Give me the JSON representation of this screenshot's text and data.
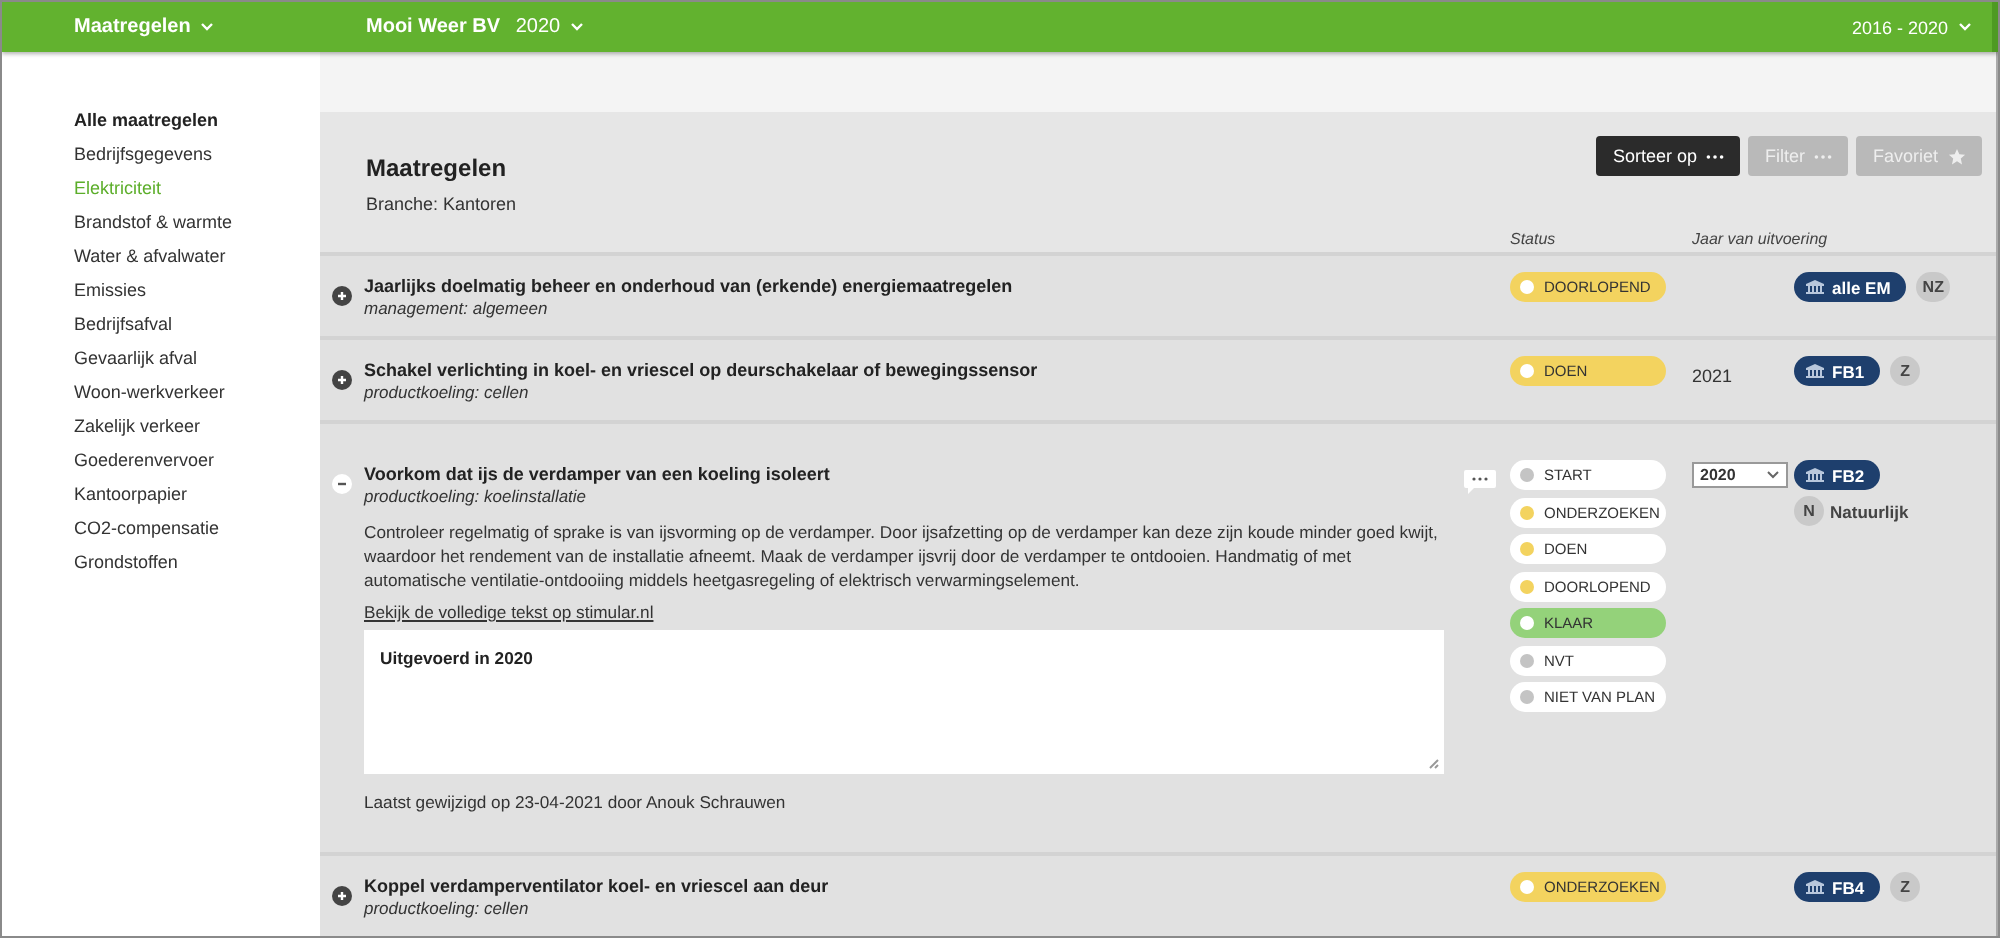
{
  "topbar": {
    "menu": "Maatregelen",
    "company": "Mooi Weer BV",
    "year": "2020",
    "period": "2016 - 2020"
  },
  "sidebar": {
    "items": [
      {
        "label": "Alle maatregelen",
        "kind": "heading",
        "selected": false
      },
      {
        "label": "Bedrijfsgegevens",
        "kind": "link",
        "selected": false
      },
      {
        "label": "Elektriciteit",
        "kind": "link",
        "selected": true
      },
      {
        "label": "Brandstof & warmte",
        "kind": "link",
        "selected": false
      },
      {
        "label": "Water & afvalwater",
        "kind": "link",
        "selected": false
      },
      {
        "label": "Emissies",
        "kind": "link",
        "selected": false
      },
      {
        "label": "Bedrijfsafval",
        "kind": "link",
        "selected": false
      },
      {
        "label": "Gevaarlijk afval",
        "kind": "link",
        "selected": false
      },
      {
        "label": "Woon-werkverkeer",
        "kind": "link",
        "selected": false
      },
      {
        "label": "Zakelijk verkeer",
        "kind": "link",
        "selected": false
      },
      {
        "label": "Goederenvervoer",
        "kind": "link",
        "selected": false
      },
      {
        "label": "Kantoorpapier",
        "kind": "link",
        "selected": false
      },
      {
        "label": "CO2-compensatie",
        "kind": "link",
        "selected": false
      },
      {
        "label": "Grondstoffen",
        "kind": "link",
        "selected": false
      }
    ]
  },
  "header": {
    "title": "Maatregelen",
    "branch": "Branche: Kantoren",
    "buttons": [
      {
        "label": "Sorteer op",
        "disabled": false
      },
      {
        "label": "Filter",
        "disabled": true
      },
      {
        "label": "Favoriet",
        "disabled": true
      }
    ],
    "columns": [
      "Status",
      "Jaar van uitvoering"
    ]
  },
  "rows": [
    {
      "expanded": false,
      "title": "Jaarlijks doelmatig beheer en onderhoud van (erkende) energiemaatregelen",
      "category": "management: algemeen",
      "status": {
        "label": "DOORLOPEND",
        "color": "#f3d35f"
      },
      "tags": [
        {
          "kind": "code",
          "label": "alle EM"
        },
        {
          "kind": "letter",
          "label": "NZ"
        }
      ]
    },
    {
      "expanded": false,
      "title": "Schakel verlichting in koel- en vriescel op deurschakelaar of bewegingssensor",
      "category": "productkoeling: cellen",
      "status": {
        "label": "DOEN",
        "color": "#f3d35f"
      },
      "year": "2021",
      "tags": [
        {
          "kind": "code",
          "label": "FB1"
        },
        {
          "kind": "letter",
          "label": "Z"
        }
      ]
    },
    {
      "expanded": true,
      "title": "Voorkom dat ijs de verdamper van een koeling isoleert",
      "category": "productkoeling: koelinstallatie",
      "description": "Controleer regelmatig of sprake is van ijsvorming op de verdamper. Door ijsafzetting op de verdamper kan deze zijn koude minder goed kwijt, waardoor het rendement van de installatie afneemt. Maak de verdamper ijsvrij door de verdamper te ontdooien. Handmatig of met automatische ventilatie-ontdooiing middels heetgasregeling of elektrisch verwarmingselement.",
      "link": "Bekijk de volledige tekst op stimular.nl",
      "note": "Uitgevoerd in 2020",
      "modified": "Laatst gewijzigd op 23-04-2021 door Anouk Schrauwen",
      "status_options": [
        {
          "label": "START",
          "color": "#c4c4c4",
          "selected": false
        },
        {
          "label": "ONDERZOEKEN",
          "color": "#f3d35f",
          "selected": false
        },
        {
          "label": "DOEN",
          "color": "#f3d35f",
          "selected": false
        },
        {
          "label": "DOORLOPEND",
          "color": "#f3d35f",
          "selected": false
        },
        {
          "label": "KLAAR",
          "color": "#ffffff",
          "selected": true
        },
        {
          "label": "NVT",
          "color": "#c4c4c4",
          "selected": false
        },
        {
          "label": "NIET VAN PLAN",
          "color": "#c4c4c4",
          "selected": false
        }
      ],
      "year_select": "2020",
      "tags": [
        {
          "kind": "code",
          "label": "FB2"
        },
        {
          "kind": "letter",
          "label": "N",
          "text": "Natuurlijk"
        }
      ]
    },
    {
      "expanded": false,
      "title": "Koppel verdamperventilator koel- en vriescel aan deur",
      "category": "productkoeling: cellen",
      "status": {
        "label": "ONDERZOEKEN",
        "color": "#f3d35f"
      },
      "tags": [
        {
          "kind": "code",
          "label": "FB4"
        },
        {
          "kind": "letter",
          "label": "Z"
        }
      ]
    }
  ]
}
